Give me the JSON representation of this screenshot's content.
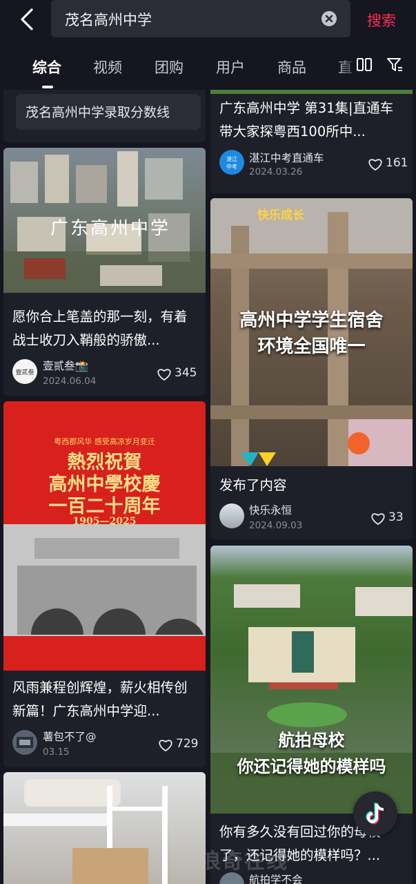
{
  "search": {
    "query": "茂名高州中学",
    "button_label": "搜索"
  },
  "tabs": [
    "综合",
    "视频",
    "团购",
    "用户",
    "商品",
    "直"
  ],
  "suggestion": "茂名高州中学录取分数线",
  "cards_left": [
    {
      "overlay": "广东高州中学",
      "title": "愿你合上笔盖的那一刻，有着战士收刀入鞘般的骄傲...",
      "author": "壹贰叁📸",
      "date": "2024.06.04",
      "likes": "345"
    },
    {
      "overlay_top": "粤西郡风华 感受高凉岁月变迁",
      "overlay_line1": "熱烈祝賀",
      "overlay_line2": "高州中學校慶",
      "overlay_line3": "一百二十周年",
      "overlay_years": "1905—2025",
      "title": "风雨兼程创辉煌，薪火相传创新篇！广东高州中学迎...",
      "author": "薯包不了@",
      "date": "03.15",
      "likes": "729"
    }
  ],
  "cards_right": [
    {
      "title": "广东高州中学 第31集|直通车带大家探粤西100所中...",
      "author": "湛江中考直通车",
      "date": "2024.03.26",
      "likes": "161"
    },
    {
      "overlay_badge": "快乐成长",
      "overlay_line1": "高州中学学生宿舍",
      "overlay_line2": "环境全国唯一",
      "title": "发布了内容",
      "author": "快乐永恒",
      "date": "2024.09.03",
      "likes": "33"
    },
    {
      "overlay_line1": "航拍母校",
      "overlay_line2": "你还记得她的模样吗",
      "title": "你有多久没有回过你的母校了，还记得她的模样吗？...",
      "author": "航拍学不会"
    }
  ],
  "watermark": "浪奇在线",
  "colors": {
    "accent": "#fe2c55",
    "background": "#15161f",
    "card": "#1e2029"
  }
}
